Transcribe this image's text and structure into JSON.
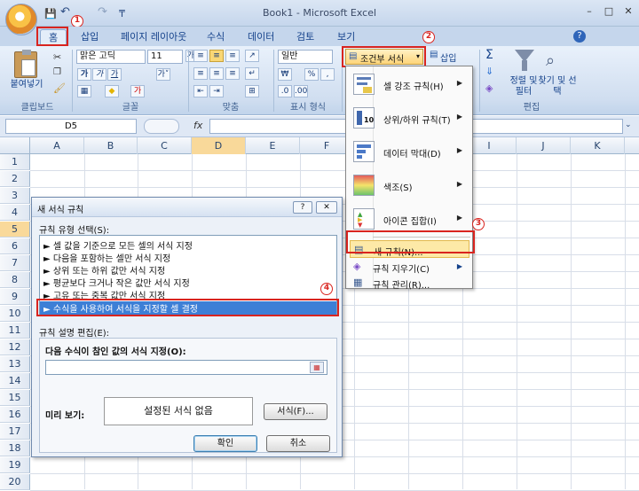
{
  "window": {
    "title": "Book1 - Microsoft Excel"
  },
  "window_controls": {
    "min": "–",
    "max": "□",
    "close": "✕"
  },
  "qat": {
    "save": "💾",
    "undo": "↶",
    "redo": "↷",
    "customize": "₸"
  },
  "tabs": [
    {
      "label": "홈",
      "active": true
    },
    {
      "label": "삽입"
    },
    {
      "label": "페이지 레이아웃"
    },
    {
      "label": "수식"
    },
    {
      "label": "데이터"
    },
    {
      "label": "검토"
    },
    {
      "label": "보기"
    }
  ],
  "help_icon": "?",
  "ribbon": {
    "clipboard": {
      "paste": "붙여넣기",
      "label": "클립보드"
    },
    "font": {
      "name": "맑은 고딕",
      "size": "11",
      "grow": "가˄",
      "shrink": "가˅",
      "bold": "가",
      "italic": "가",
      "underline": "가",
      "fontcolor": "가",
      "fill": "◆",
      "border": "▦",
      "label": "글꼴"
    },
    "alignment": {
      "label": "맞춤"
    },
    "number": {
      "format": "일반",
      "currency": "₩",
      "percent": "%",
      "comma": ",",
      "label": "표시 형식"
    },
    "styles": {
      "conditional": "조건부 서식"
    },
    "cells": {
      "insert": "삽입"
    },
    "editing": {
      "sum": "Σ",
      "sort": "정렬 및 필터",
      "find": "찾기 및 선택",
      "label": "편집"
    }
  },
  "formula_bar": {
    "name_box": "D5",
    "fx": "fx",
    "value": ""
  },
  "grid": {
    "columns": [
      "A",
      "B",
      "C",
      "D",
      "E",
      "F",
      "G",
      "H",
      "I",
      "J",
      "K"
    ],
    "rows": [
      "1",
      "2",
      "3",
      "4",
      "5",
      "6",
      "7",
      "8",
      "9",
      "10",
      "11",
      "12",
      "13",
      "14",
      "15",
      "16",
      "17",
      "18",
      "19",
      "20"
    ],
    "active_cell": "D5"
  },
  "cf_menu": {
    "items": [
      {
        "label": "셀 강조 규칙(H)"
      },
      {
        "label": "상위/하위 규칙(T)"
      },
      {
        "label": "데이터 막대(D)"
      },
      {
        "label": "색조(S)"
      },
      {
        "label": "아이콘 집합(I)"
      }
    ],
    "new_rule": "새 규칙(N)...",
    "clear_rules": "규칙 지우기(C)",
    "manage_rules": "규칙 관리(R)..."
  },
  "dialog": {
    "title": "새 서식 규칙",
    "help": "?",
    "close": "✕",
    "rule_type_label": "규칙 유형 선택(S):",
    "rule_types": [
      "► 셀 값을 기준으로 모든 셀의 서식 지정",
      "► 다음을 포함하는 셀만 서식 지정",
      "► 상위 또는 하위 값만 서식 지정",
      "► 평균보다 크거나 작은 값만 서식 지정",
      "► 고유 또는 중복 값만 서식 지정",
      "► 수식을 사용하여 서식을 지정할 셀 결정"
    ],
    "edit_label": "규칙 설명 편집(E):",
    "formula_label": "다음 수식이 참인 값의 서식 지정(O):",
    "formula_value": "",
    "preview_label": "미리 보기:",
    "preview_text": "설정된 서식 없음",
    "format_button": "서식(F)...",
    "ok": "확인",
    "cancel": "취소"
  },
  "annotations": {
    "n1": "1",
    "n2": "2",
    "n3": "3",
    "n4": "4"
  },
  "colors": {
    "callout": "#d9241f",
    "selected_row": "#3d7fd6",
    "highlight_item": "#fde9a7"
  }
}
